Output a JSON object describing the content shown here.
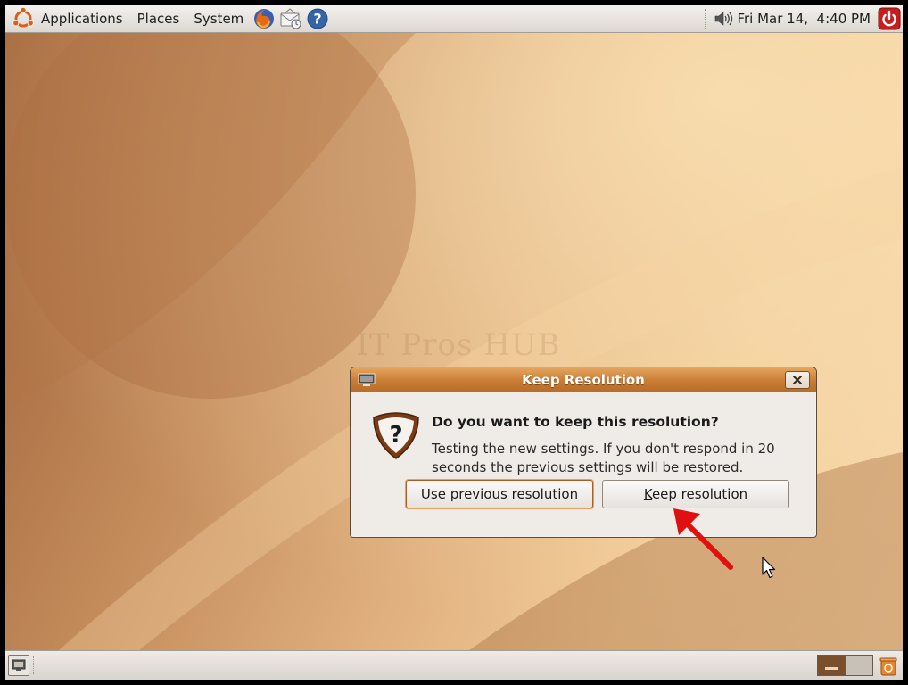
{
  "top_panel": {
    "menus": [
      {
        "label": "Applications",
        "icon": "ubuntu-logo-icon"
      },
      {
        "label": "Places"
      },
      {
        "label": "System"
      }
    ],
    "launchers": [
      "firefox-icon",
      "mail-icon",
      "help-icon"
    ],
    "volume_icon": "speaker-icon",
    "clock": "Fri Mar 14,  4:40 PM",
    "power_icon": "power-icon"
  },
  "watermark": "IT Pros HUB",
  "dialog": {
    "title": "Keep Resolution",
    "heading": "Do you want to keep this resolution?",
    "body": "Testing the new settings. If you don't respond in 20 seconds the previous settings will be restored.",
    "buttons": {
      "previous": "Use previous resolution",
      "keep_prefix": "",
      "keep_mnemonic": "K",
      "keep_rest": "eep resolution"
    },
    "icon": "question-warning-icon"
  },
  "bottom_panel": {
    "show_desktop_icon": "show-desktop-icon",
    "workspaces": [
      {
        "active": true
      },
      {
        "active": false
      }
    ],
    "trash_icon": "trash-icon"
  },
  "colors": {
    "titlebar": "#c97d35",
    "annotation_arrow": "#e01010",
    "panel": "#dcd7d1"
  }
}
